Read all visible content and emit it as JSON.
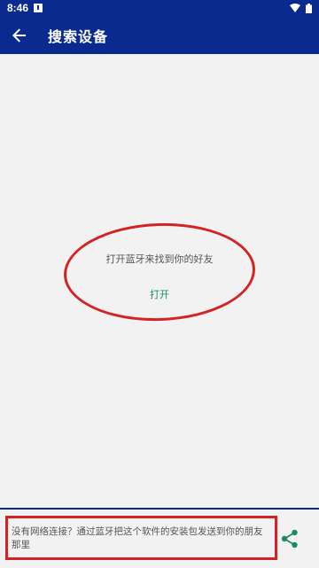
{
  "status_bar": {
    "time": "8:46"
  },
  "app_bar": {
    "title": "搜索设备"
  },
  "main": {
    "bluetooth_message": "打开蓝牙来找到你的好友",
    "open_button": "打开"
  },
  "bottom": {
    "offline_message": "没有网络连接？通过蓝牙把这个软件的安装包发送到你的朋友那里"
  },
  "colors": {
    "primary": "#0b2a8f",
    "accent": "#1a8a6b",
    "highlight": "#d42323",
    "background": "#f2f2f2"
  },
  "icons": {
    "back": "arrow-back-icon",
    "share": "share-icon",
    "wifi": "wifi-icon",
    "battery": "battery-icon",
    "notification": "notification-icon"
  }
}
